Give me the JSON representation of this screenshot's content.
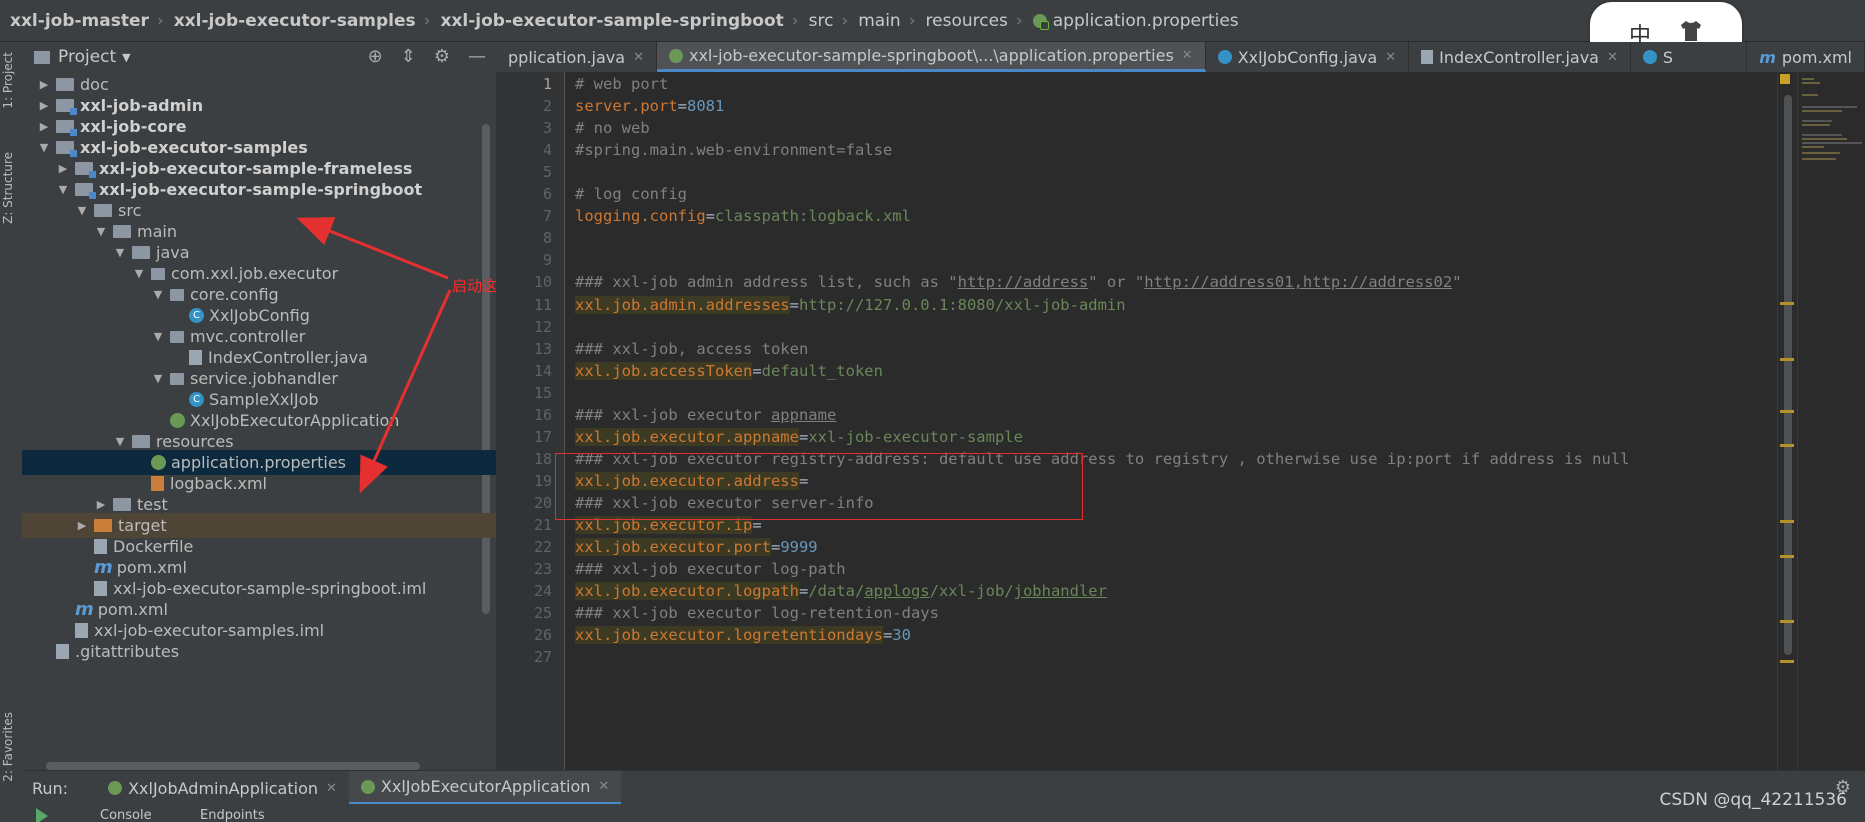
{
  "breadcrumb": [
    "xxl-job-master",
    "xxl-job-executor-samples",
    "xxl-job-executor-sample-springboot",
    "src",
    "main",
    "resources",
    "application.properties"
  ],
  "ime": {
    "mode": "中",
    "icon": "shirt-icon"
  },
  "left_strip": {
    "project": "1: Project",
    "structure": "Z: Structure",
    "favorites": "2: Favorites"
  },
  "project_panel": {
    "title": "Project"
  },
  "tree": [
    {
      "label": "doc",
      "indent": 1,
      "arrow": "right",
      "icon": "folder"
    },
    {
      "label": "xxl-job-admin",
      "indent": 1,
      "arrow": "right",
      "icon": "module",
      "bold": true
    },
    {
      "label": "xxl-job-core",
      "indent": 1,
      "arrow": "right",
      "icon": "module",
      "bold": true
    },
    {
      "label": "xxl-job-executor-samples",
      "indent": 1,
      "arrow": "down",
      "icon": "module",
      "bold": true
    },
    {
      "label": "xxl-job-executor-sample-frameless",
      "indent": 2,
      "arrow": "right",
      "icon": "module",
      "bold": true
    },
    {
      "label": "xxl-job-executor-sample-springboot",
      "indent": 2,
      "arrow": "down",
      "icon": "module",
      "bold": true
    },
    {
      "label": "src",
      "indent": 3,
      "arrow": "down",
      "icon": "folder"
    },
    {
      "label": "main",
      "indent": 4,
      "arrow": "down",
      "icon": "folder"
    },
    {
      "label": "java",
      "indent": 5,
      "arrow": "down",
      "icon": "folder"
    },
    {
      "label": "com.xxl.job.executor",
      "indent": 6,
      "arrow": "down",
      "icon": "package"
    },
    {
      "label": "core.config",
      "indent": 7,
      "arrow": "down",
      "icon": "package"
    },
    {
      "label": "XxlJobConfig",
      "indent": 8,
      "arrow": "",
      "icon": "class"
    },
    {
      "label": "mvc.controller",
      "indent": 7,
      "arrow": "down",
      "icon": "package"
    },
    {
      "label": "IndexController.java",
      "indent": 8,
      "arrow": "",
      "icon": "java"
    },
    {
      "label": "service.jobhandler",
      "indent": 7,
      "arrow": "down",
      "icon": "package"
    },
    {
      "label": "SampleXxlJob",
      "indent": 8,
      "arrow": "",
      "icon": "class"
    },
    {
      "label": "XxlJobExecutorApplication",
      "indent": 7,
      "arrow": "",
      "icon": "spring"
    },
    {
      "label": "resources",
      "indent": 5,
      "arrow": "down",
      "icon": "folder"
    },
    {
      "label": "application.properties",
      "indent": 6,
      "arrow": "",
      "icon": "spring",
      "selected": true
    },
    {
      "label": "logback.xml",
      "indent": 6,
      "arrow": "",
      "icon": "xml"
    },
    {
      "label": "test",
      "indent": 4,
      "arrow": "right",
      "icon": "folder"
    },
    {
      "label": "target",
      "indent": 3,
      "arrow": "right",
      "icon": "folder-orange",
      "target": true
    },
    {
      "label": "Dockerfile",
      "indent": 3,
      "arrow": "",
      "icon": "file"
    },
    {
      "label": "pom.xml",
      "indent": 3,
      "arrow": "",
      "icon": "maven"
    },
    {
      "label": "xxl-job-executor-sample-springboot.iml",
      "indent": 3,
      "arrow": "",
      "icon": "file"
    },
    {
      "label": "pom.xml",
      "indent": 2,
      "arrow": "",
      "icon": "maven"
    },
    {
      "label": "xxl-job-executor-samples.iml",
      "indent": 2,
      "arrow": "",
      "icon": "file"
    },
    {
      "label": ".gitattributes",
      "indent": 1,
      "arrow": "",
      "icon": "file"
    }
  ],
  "annotation": {
    "text": "启动这个示例执行器",
    "color": "#ff2a2a"
  },
  "tabs": [
    {
      "label": "Application.java",
      "partial": "pplication.java",
      "icon": "",
      "close": true
    },
    {
      "label": "xxl-job-executor-sample-springboot\\...\\application.properties",
      "icon": "spring",
      "active": true,
      "close": true
    },
    {
      "label": "XxlJobConfig.java",
      "icon": "class",
      "close": true
    },
    {
      "label": "IndexController.java",
      "icon": "java",
      "close": true
    },
    {
      "label": "S",
      "icon": "class",
      "close": false
    },
    {
      "label": "pom.xml",
      "icon": "maven",
      "close": false
    }
  ],
  "code_lines": [
    {
      "n": "1",
      "segs": [
        [
          "cmt",
          "# web port"
        ]
      ]
    },
    {
      "n": "2",
      "segs": [
        [
          "key",
          "server.port"
        ],
        [
          "eq",
          "="
        ],
        [
          "num",
          "8081"
        ]
      ]
    },
    {
      "n": "3",
      "segs": [
        [
          "cmt",
          "# no web"
        ]
      ]
    },
    {
      "n": "4",
      "segs": [
        [
          "cmt",
          "#spring.main.web-environment=false"
        ]
      ]
    },
    {
      "n": "5",
      "segs": []
    },
    {
      "n": "6",
      "segs": [
        [
          "cmt",
          "# log config"
        ]
      ]
    },
    {
      "n": "7",
      "segs": [
        [
          "key",
          "logging.config"
        ],
        [
          "eq",
          "="
        ],
        [
          "val",
          "classpath:logback.xml"
        ]
      ]
    },
    {
      "n": "8",
      "segs": []
    },
    {
      "n": "9",
      "segs": []
    },
    {
      "n": "10",
      "segs": [
        [
          "cmt",
          "### xxl-job admin address list, such as \""
        ],
        [
          "cmtu",
          "http://address"
        ],
        [
          "cmt",
          "\" or \""
        ],
        [
          "cmtu",
          "http://address01,http://address02"
        ],
        [
          "cmt",
          "\""
        ]
      ]
    },
    {
      "n": "11",
      "segs": [
        [
          "hk",
          "xxl.job.admin.addresses"
        ],
        [
          "eq",
          "="
        ],
        [
          "val",
          "http://127.0.0.1:8080/xxl-job-admin"
        ]
      ]
    },
    {
      "n": "12",
      "segs": []
    },
    {
      "n": "13",
      "segs": [
        [
          "cmt",
          "### xxl-job, access token"
        ]
      ]
    },
    {
      "n": "14",
      "segs": [
        [
          "hk",
          "xxl.job.accessToken"
        ],
        [
          "eq",
          "="
        ],
        [
          "val",
          "default_token"
        ]
      ]
    },
    {
      "n": "15",
      "segs": []
    },
    {
      "n": "16",
      "segs": [
        [
          "cmt",
          "### xxl-job executor "
        ],
        [
          "cmtu",
          "appname"
        ]
      ]
    },
    {
      "n": "17",
      "segs": [
        [
          "hk",
          "xxl.job.executor.appname"
        ],
        [
          "eq",
          "="
        ],
        [
          "val",
          "xxl-job-executor-sample"
        ]
      ]
    },
    {
      "n": "18",
      "segs": [
        [
          "cmt",
          "### xxl-job executor registry-address: default use address to registry , otherwise use ip:port if address is null"
        ]
      ]
    },
    {
      "n": "19",
      "segs": [
        [
          "hk",
          "xxl.job.executor.address"
        ],
        [
          "eq",
          "="
        ]
      ]
    },
    {
      "n": "20",
      "segs": [
        [
          "cmt",
          "### xxl-job executor server-info"
        ]
      ]
    },
    {
      "n": "21",
      "segs": [
        [
          "hk",
          "xxl.job.executor.ip"
        ],
        [
          "eq",
          "="
        ]
      ]
    },
    {
      "n": "22",
      "segs": [
        [
          "hk",
          "xxl.job.executor.port"
        ],
        [
          "eq",
          "="
        ],
        [
          "num",
          "9999"
        ]
      ]
    },
    {
      "n": "23",
      "segs": [
        [
          "cmt",
          "### xxl-job executor log-path"
        ]
      ]
    },
    {
      "n": "24",
      "segs": [
        [
          "hk",
          "xxl.job.executor.logpath"
        ],
        [
          "eq",
          "="
        ],
        [
          "val",
          "/data/"
        ],
        [
          "valu",
          "applogs"
        ],
        [
          "val",
          "/xxl-job/"
        ],
        [
          "valu",
          "jobhandler"
        ]
      ]
    },
    {
      "n": "25",
      "segs": [
        [
          "cmt",
          "### xxl-job executor log-retention-days"
        ]
      ]
    },
    {
      "n": "26",
      "segs": [
        [
          "hk",
          "xxl.job.executor.logretentiondays"
        ],
        [
          "eq",
          "="
        ],
        [
          "num",
          "30"
        ]
      ]
    },
    {
      "n": "27",
      "segs": []
    }
  ],
  "run_bar": {
    "label": "Run:",
    "tabs": [
      {
        "label": "XxlJobAdminApplication"
      },
      {
        "label": "XxlJobExecutorApplication",
        "active": true
      }
    ]
  },
  "sub_bar": {
    "console": "Console",
    "endpoints": "Endpoints"
  },
  "watermark": "CSDN @qq_42211536",
  "colors": {
    "keyword": "#cc7832",
    "comment": "#808080",
    "string": "#6a8759",
    "number": "#6897bb",
    "annotation": "#ff2a2a",
    "selection": "#0d293e"
  }
}
